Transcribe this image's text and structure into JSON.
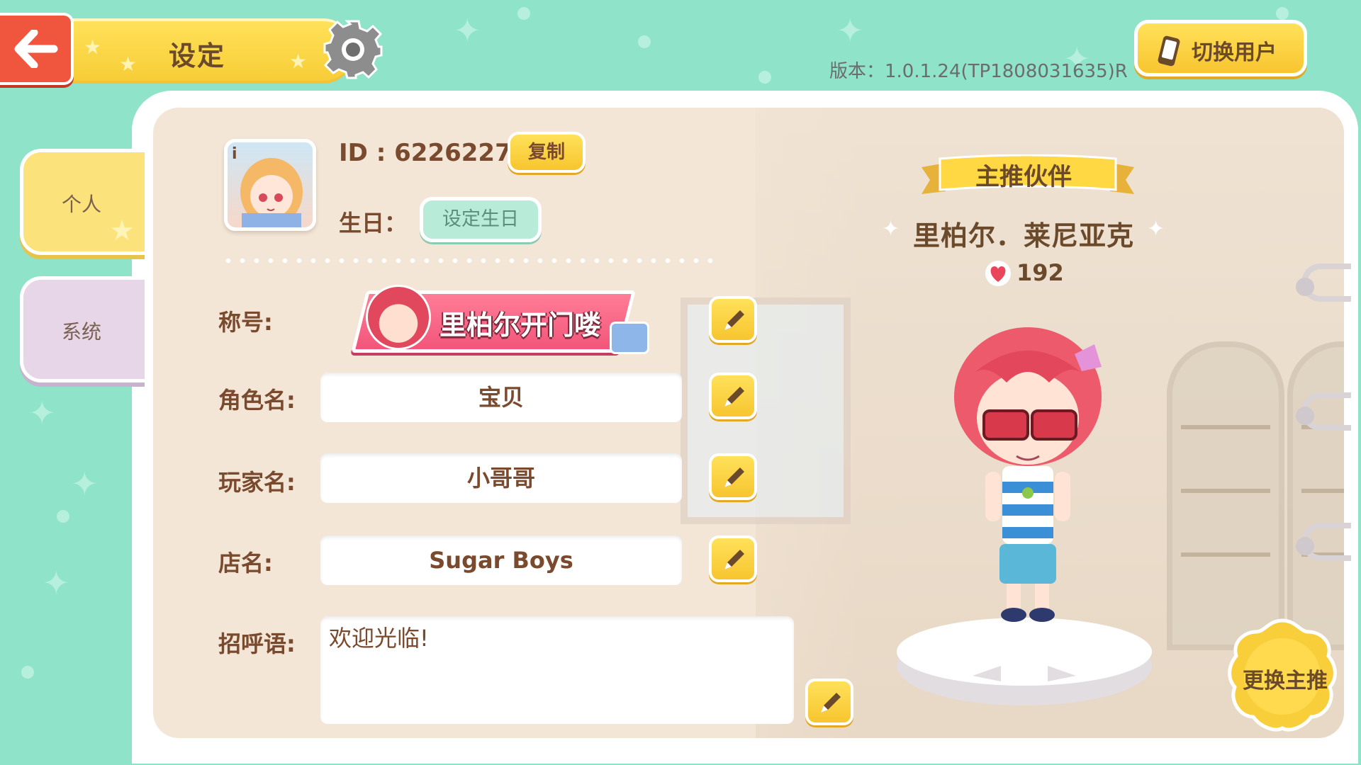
{
  "header": {
    "back_icon": "back-arrow-icon",
    "title": "设定",
    "settings_icon": "gear-icon",
    "version": "版本：1.0.1.24(TP1808031635)R",
    "switch_user_label": "切换用户",
    "switch_user_icon": "phone-icon"
  },
  "sidebar": {
    "tabs": [
      {
        "label": "个人",
        "active": true
      },
      {
        "label": "系统",
        "active": false
      }
    ]
  },
  "profile": {
    "avatar_icon": "info-icon",
    "avatar_badge": "i",
    "id_text": "ID : 62262273",
    "copy_label": "复制",
    "birthday_label": "生日：",
    "birthday_button": "设定生日"
  },
  "fields": {
    "title_label": "称号:",
    "title_badge": "里柏尔开门喽",
    "role_label": "角色名:",
    "role_value": "宝贝",
    "player_label": "玩家名:",
    "player_value": "小哥哥",
    "shop_label": "店名:",
    "shop_value": "Sugar Boys",
    "greeting_label": "招呼语:",
    "greeting_value": "欢迎光临!",
    "edit_icon": "pencil-icon"
  },
  "partner": {
    "ribbon_label": "主推伙伴",
    "name": "里柏尔．莱尼亚克",
    "heart_icon": "heart-icon",
    "affection": "192",
    "change_button": "更换主推"
  },
  "colors": {
    "background": "#8fe3c9",
    "accent_yellow": "#f7cd36",
    "back_red": "#f0553e",
    "mint_button": "#b9ecd8",
    "title_pink": "#f2557a"
  }
}
